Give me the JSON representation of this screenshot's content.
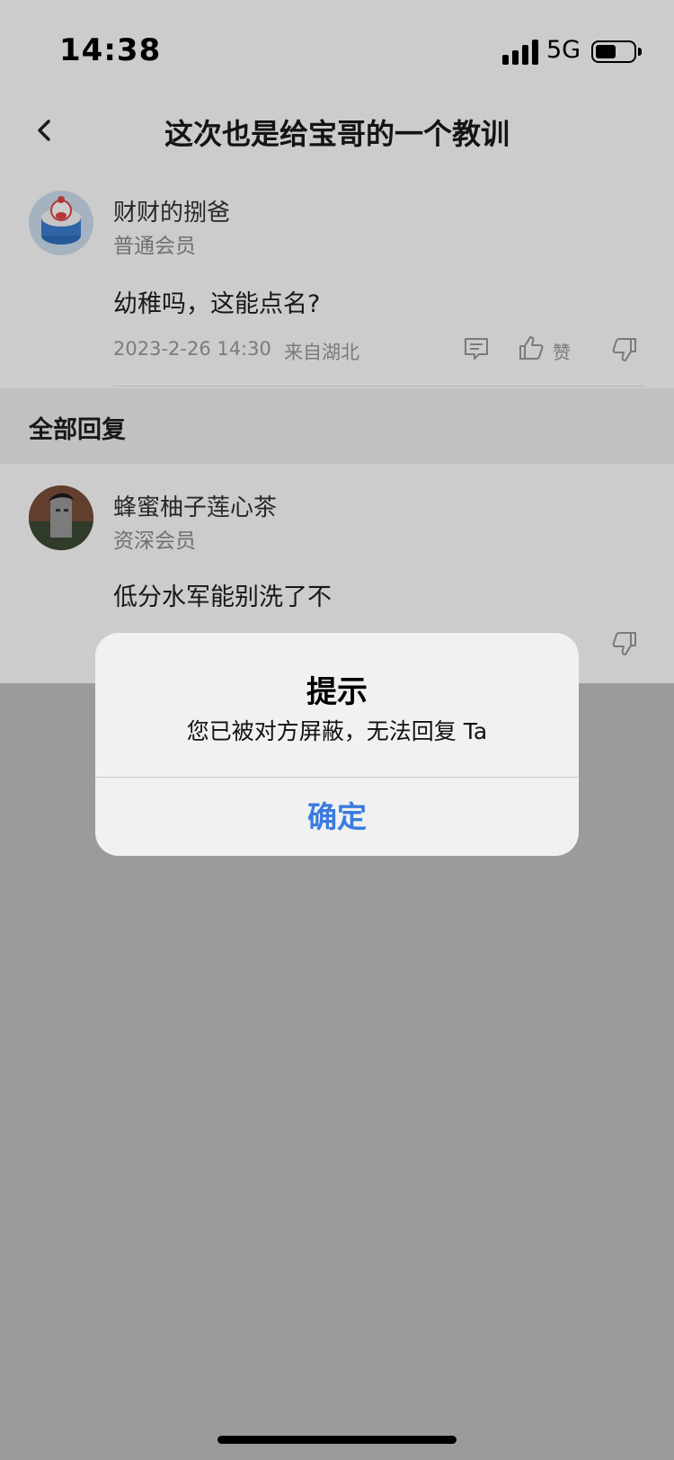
{
  "status_bar": {
    "time": "14:38",
    "network": "5G",
    "battery_level": 0.5
  },
  "nav": {
    "title": "这次也是给宝哥的一个教训",
    "back_icon": "chevron-left-icon"
  },
  "post": {
    "username": "财财的捌爸",
    "level": "普通会员",
    "content": "幼稚吗，这能点名?",
    "timestamp": "2023-2-26 14:30",
    "location": "来自湖北",
    "like_label": "赞"
  },
  "replies_section": {
    "title": "全部回复"
  },
  "replies": [
    {
      "username": "蜂蜜柚子莲心茶",
      "level": "资深会员",
      "content": "低分水军能别洗了不"
    }
  ],
  "dialog": {
    "title": "提示",
    "message": "您已被对方屏蔽，无法回复 Ta",
    "confirm_label": "确定",
    "confirm_color": "#3a7be0"
  }
}
